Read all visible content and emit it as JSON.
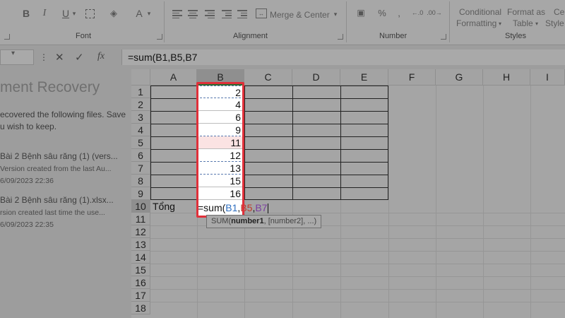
{
  "ribbon": {
    "groups": {
      "font": "Font",
      "alignment": "Alignment",
      "number": "Number",
      "styles": "Styles"
    },
    "buttons": {
      "bold": "B",
      "italic": "I",
      "underline": "U",
      "merge_center": "Merge & Center",
      "conditional_line1": "Conditional",
      "conditional_line2": "Formatting",
      "format_table_line1": "Format as",
      "format_table_line2": "Table",
      "cell_styles_line1": "Ce",
      "cell_styles_line2": "Style"
    }
  },
  "formula_bar": {
    "fx": "fx",
    "formula": "=sum(B1,B5,B7"
  },
  "recovery": {
    "title": "ment Recovery",
    "desc_line1": "ecovered the following files.  Save",
    "desc_line2": "u wish to keep.",
    "files": [
      {
        "name": "Bài 2 Bệnh sâu răng (1) (vers...",
        "note": "Version created from the last Au...",
        "date": "6/09/2023 22:36"
      },
      {
        "name": "Bài 2 Bệnh sâu răng (1).xlsx...",
        "note": "rsion created last time the use...",
        "date": "6/09/2023 22:35"
      }
    ]
  },
  "sheet": {
    "columns": [
      "A",
      "B",
      "C",
      "D",
      "E",
      "F",
      "G",
      "H",
      "I"
    ],
    "rows": [
      "1",
      "2",
      "3",
      "4",
      "5",
      "6",
      "7",
      "8",
      "9",
      "10",
      "11",
      "12",
      "13",
      "14",
      "15",
      "16",
      "17",
      "18"
    ],
    "b_values": [
      "2",
      "4",
      "6",
      "9",
      "11",
      "12",
      "13",
      "15",
      "16"
    ],
    "a10": "Tổng",
    "formula_parts": {
      "p1": "=sum(",
      "p2": "B1",
      "p3": ",",
      "p4": "B5",
      "p5": ",",
      "p6": "B7"
    },
    "tooltip": {
      "fn": "SUM(",
      "arg1": "number1",
      "rest": ", [number2], ...)"
    }
  },
  "colors": {
    "highlight_border": "#e0303a",
    "ref_b1": "#2f6fc0",
    "ref_b5": "#c0392b",
    "ref_b7": "#7a3fa0"
  }
}
